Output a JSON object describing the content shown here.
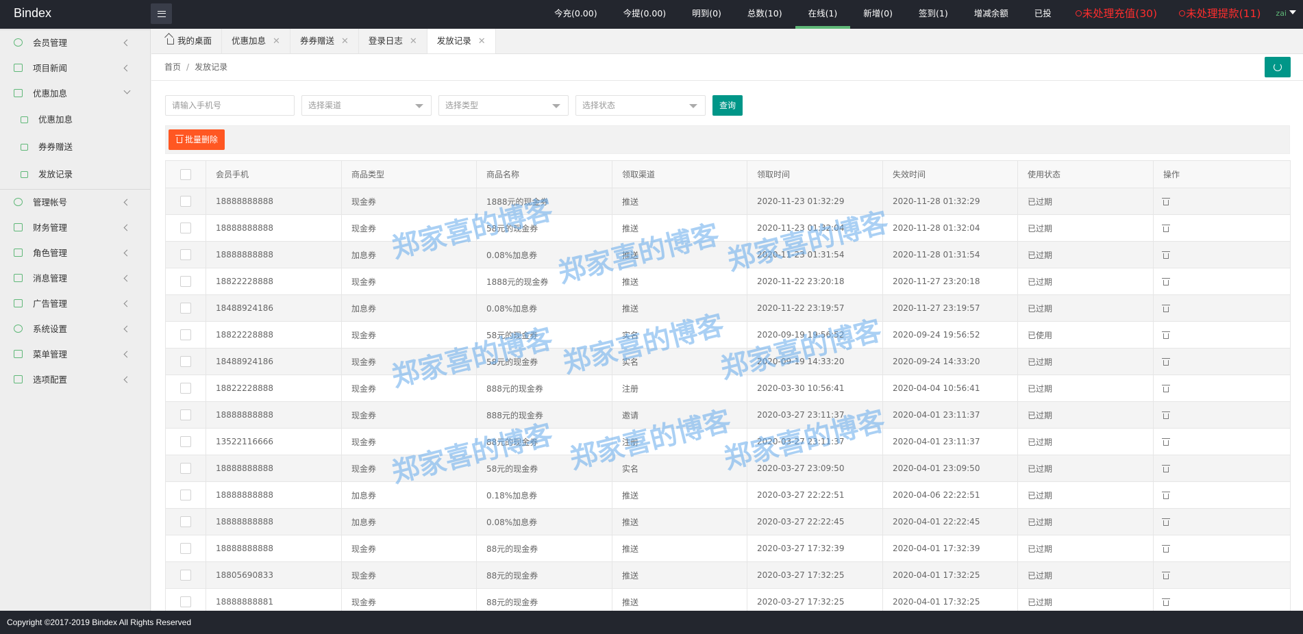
{
  "app": {
    "logo": "Bindex"
  },
  "top_nav": [
    {
      "label": "今充(0.00)",
      "style": "normal"
    },
    {
      "label": "今提(0.00)",
      "style": "normal"
    },
    {
      "label": "明到(0)",
      "style": "normal"
    },
    {
      "label": "总数(10)",
      "style": "normal"
    },
    {
      "label": "在线(1)",
      "style": "active"
    },
    {
      "label": "新增(0)",
      "style": "normal"
    },
    {
      "label": "签到(1)",
      "style": "normal"
    },
    {
      "label": "增减余额",
      "style": "normal"
    },
    {
      "label": "已投",
      "style": "normal"
    },
    {
      "label": "未处理充值(30)",
      "style": "alert"
    },
    {
      "label": "未处理提款(11)",
      "style": "alert"
    }
  ],
  "user": {
    "name": "zai"
  },
  "sidebar": {
    "items": [
      {
        "label": "会员管理",
        "expanded": false
      },
      {
        "label": "项目新闻",
        "expanded": false
      },
      {
        "label": "优惠加息",
        "expanded": true,
        "children": [
          "优惠加息",
          "券券赠送",
          "发放记录"
        ]
      },
      {
        "label": "管理帐号",
        "expanded": false
      },
      {
        "label": "财务管理",
        "expanded": false
      },
      {
        "label": "角色管理",
        "expanded": false
      },
      {
        "label": "消息管理",
        "expanded": false
      },
      {
        "label": "广告管理",
        "expanded": false
      },
      {
        "label": "系统设置",
        "expanded": false
      },
      {
        "label": "菜单管理",
        "expanded": false
      },
      {
        "label": "选项配置",
        "expanded": false
      }
    ]
  },
  "tabs": [
    {
      "label": "我的桌面",
      "home": true,
      "closable": false,
      "active": false
    },
    {
      "label": "优惠加息",
      "closable": true,
      "active": false
    },
    {
      "label": "券券赠送",
      "closable": true,
      "active": false
    },
    {
      "label": "登录日志",
      "closable": true,
      "active": false
    },
    {
      "label": "发放记录",
      "closable": true,
      "active": true
    }
  ],
  "breadcrumb": {
    "home": "首页",
    "separator": "/",
    "current": "发放记录"
  },
  "filters": {
    "phone_placeholder": "请输入手机号",
    "channel_placeholder": "选择渠道",
    "type_placeholder": "选择类型",
    "status_placeholder": "选择状态",
    "query_label": "查询"
  },
  "toolbar": {
    "batch_delete_label": "批量删除"
  },
  "table": {
    "headers": [
      "会员手机",
      "商品类型",
      "商品名称",
      "领取渠道",
      "领取时间",
      "失效时间",
      "使用状态",
      "操作"
    ],
    "rows": [
      [
        "18888888888",
        "现金券",
        "1888元的现金券",
        "推送",
        "2020-11-23 01:32:29",
        "2020-11-28 01:32:29",
        "已过期"
      ],
      [
        "18888888888",
        "现金券",
        "58元的现金券",
        "推送",
        "2020-11-23 01:32:04",
        "2020-11-28 01:32:04",
        "已过期"
      ],
      [
        "18888888888",
        "加息券",
        "0.08%加息券",
        "推送",
        "2020-11-23 01:31:54",
        "2020-11-28 01:31:54",
        "已过期"
      ],
      [
        "18822228888",
        "现金券",
        "1888元的现金券",
        "推送",
        "2020-11-22 23:20:18",
        "2020-11-27 23:20:18",
        "已过期"
      ],
      [
        "18488924186",
        "加息券",
        "0.08%加息券",
        "推送",
        "2020-11-22 23:19:57",
        "2020-11-27 23:19:57",
        "已过期"
      ],
      [
        "18822228888",
        "现金券",
        "58元的现金券",
        "实名",
        "2020-09-19 19:56:52",
        "2020-09-24 19:56:52",
        "已使用"
      ],
      [
        "18488924186",
        "现金券",
        "58元的现金券",
        "实名",
        "2020-09-19 14:33:20",
        "2020-09-24 14:33:20",
        "已过期"
      ],
      [
        "18822228888",
        "现金券",
        "888元的现金券",
        "注册",
        "2020-03-30 10:56:41",
        "2020-04-04 10:56:41",
        "已过期"
      ],
      [
        "18888888888",
        "现金券",
        "888元的现金券",
        "邀请",
        "2020-03-27 23:11:37",
        "2020-04-01 23:11:37",
        "已过期"
      ],
      [
        "13522116666",
        "现金券",
        "88元的现金券",
        "注册",
        "2020-03-27 23:11:37",
        "2020-04-01 23:11:37",
        "已过期"
      ],
      [
        "18888888888",
        "现金券",
        "58元的现金券",
        "实名",
        "2020-03-27 23:09:50",
        "2020-04-01 23:09:50",
        "已过期"
      ],
      [
        "18888888888",
        "加息券",
        "0.18%加息券",
        "推送",
        "2020-03-27 22:22:51",
        "2020-04-06 22:22:51",
        "已过期"
      ],
      [
        "18888888888",
        "加息券",
        "0.08%加息券",
        "推送",
        "2020-03-27 22:22:45",
        "2020-04-01 22:22:45",
        "已过期"
      ],
      [
        "18888888888",
        "现金券",
        "88元的现金券",
        "推送",
        "2020-03-27 17:32:39",
        "2020-04-01 17:32:39",
        "已过期"
      ],
      [
        "18805690833",
        "现金券",
        "88元的现金券",
        "推送",
        "2020-03-27 17:32:25",
        "2020-04-01 17:32:25",
        "已过期"
      ],
      [
        "18888888881",
        "现金券",
        "88元的现金券",
        "推送",
        "2020-03-27 17:32:25",
        "2020-04-01 17:32:25",
        "已过期"
      ]
    ]
  },
  "watermark": {
    "text": "郑家喜的博客"
  },
  "footer": {
    "copyright": "Copyright ©2017-2019 Bindex All Rights Reserved"
  },
  "colors": {
    "header_bg": "#23262e",
    "accent": "#009688",
    "nav_active": "#5fb878",
    "danger": "#ff5722",
    "alert_text": "#ff2d2d"
  }
}
